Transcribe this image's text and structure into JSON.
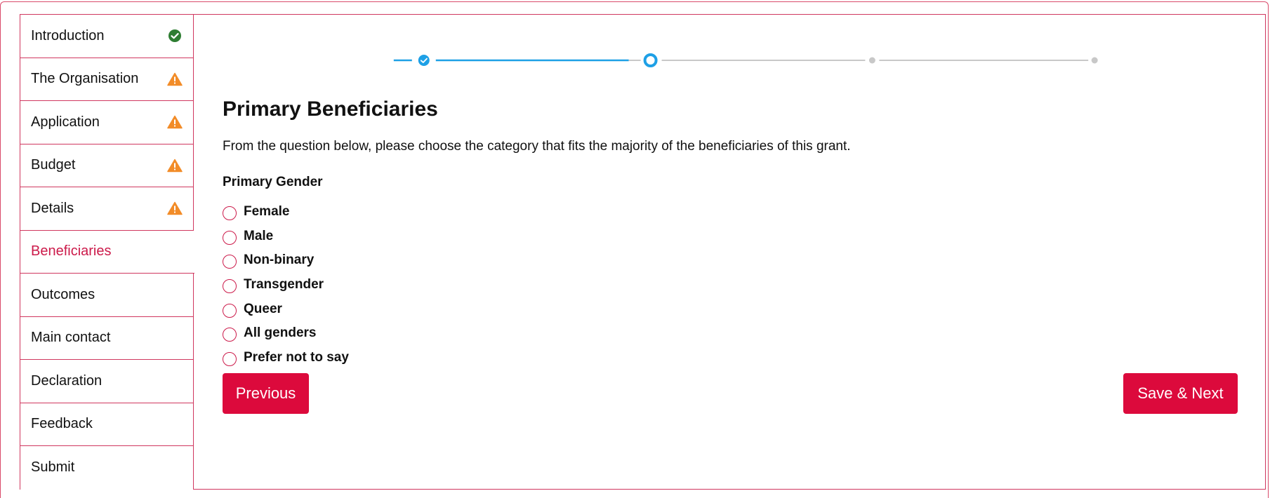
{
  "sidebar": {
    "items": [
      {
        "label": "Introduction",
        "status": "complete"
      },
      {
        "label": "The Organisation",
        "status": "warning"
      },
      {
        "label": "Application",
        "status": "warning"
      },
      {
        "label": "Budget",
        "status": "warning"
      },
      {
        "label": "Details",
        "status": "warning"
      },
      {
        "label": "Beneficiaries",
        "status": "active"
      },
      {
        "label": "Outcomes",
        "status": "none"
      },
      {
        "label": "Main contact",
        "status": "none"
      },
      {
        "label": "Declaration",
        "status": "none"
      },
      {
        "label": "Feedback",
        "status": "none"
      },
      {
        "label": "Submit",
        "status": "none"
      }
    ]
  },
  "stepper": {
    "steps": [
      "complete",
      "current",
      "upcoming",
      "upcoming"
    ]
  },
  "main": {
    "title": "Primary Beneficiaries",
    "intro": "From the question below, please choose the category that fits the majority of the beneficiaries of this grant.",
    "question_label": "Primary Gender",
    "options": [
      "Female",
      "Male",
      "Non-binary",
      "Transgender",
      "Queer",
      "All genders",
      "Prefer not to say"
    ]
  },
  "buttons": {
    "previous": "Previous",
    "save_next": "Save & Next"
  },
  "colors": {
    "accent": "#dc0a3c",
    "border": "#d0375f",
    "active_text": "#cc1a4a",
    "check_green": "#2e7d32",
    "warning_orange": "#f28c28",
    "step_blue": "#1ea0e6",
    "step_grey": "#c8c8c8"
  }
}
